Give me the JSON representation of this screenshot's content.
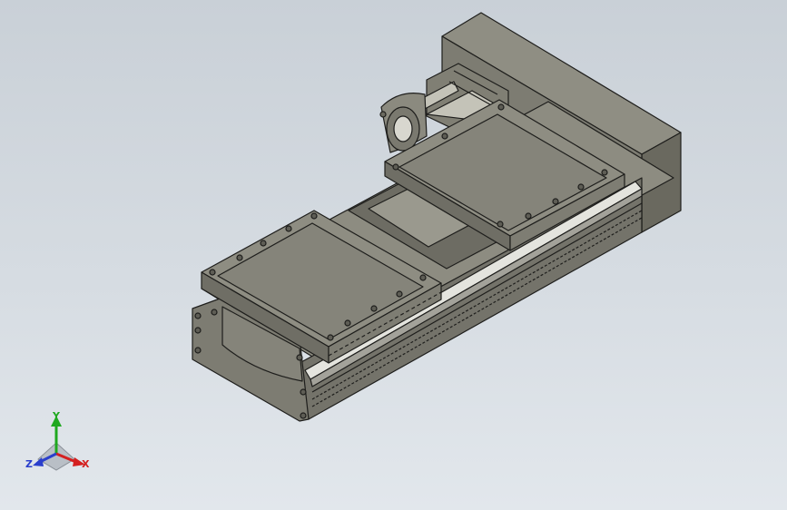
{
  "viewport": {
    "background_top": "#c9d0d7",
    "background_bottom": "#e2e7ec"
  },
  "model": {
    "body_color": "#7c7b70",
    "edge_color": "#1e1e1c",
    "rail_color": "#d6d6d0"
  },
  "triad": {
    "y_label": "Y",
    "x_label": "X",
    "z_label": "Z",
    "y_color": "#1fa81f",
    "x_color": "#d42020",
    "z_color": "#2a3fcc"
  }
}
